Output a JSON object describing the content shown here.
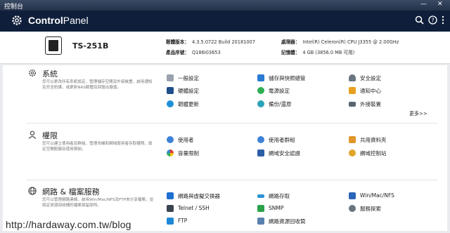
{
  "window": {
    "title": "控制台",
    "minimize": "—",
    "close": "✕"
  },
  "header": {
    "brand_bold": "Control",
    "brand_light": "Panel",
    "search_icon": "search-icon",
    "help_icon": "help-icon",
    "more_icon": "more-icon"
  },
  "device": {
    "model": "TS-251B",
    "firmware_label": "韌體版本：",
    "firmware_value": "4.3.5.0722 Build 20181007",
    "serial_label": "產品序號：",
    "serial_value": "Q186I03653",
    "cpu_label": "處理器：",
    "cpu_value": "Intel(R) Celeron(R) CPU J3355 @ 2.00GHz",
    "memory_label": "記憶體：",
    "memory_value": "4 GB (3856.0 MB 可用)"
  },
  "sections": {
    "system": {
      "title": "系統",
      "desc": "您可以更改所有系統設定，管理儲存空間及外接裝置，啟用通知及安全防護，或更新NAS韌體及回復出廠值。",
      "items": [
        {
          "label": "一般設定",
          "color": "#9aa3ad"
        },
        {
          "label": "儲存與快照總管",
          "color": "#2a7bd4"
        },
        {
          "label": "安全設定",
          "color": "#6b7580"
        },
        {
          "label": "硬體設定",
          "color": "#1f4e8c"
        },
        {
          "label": "電源設定",
          "color": "#2fae55"
        },
        {
          "label": "通知中心",
          "color": "#e8a020"
        },
        {
          "label": "韌體更新",
          "color": "#1e8fd6"
        },
        {
          "label": "備份/還原",
          "color": "#2aa3b8"
        },
        {
          "label": "外接裝置",
          "color": "#5a6470"
        }
      ],
      "more": "更多>>"
    },
    "privilege": {
      "title": "權限",
      "desc": "您可以建立使用者及群組，管理本機和網域使用者存取權限，設定空間配額及使用限制。",
      "items": [
        {
          "label": "使用者",
          "color": "#3d82d6"
        },
        {
          "label": "使用者群組",
          "color": "#3d82d6"
        },
        {
          "label": "共用資料夾",
          "color": "#e0962a"
        },
        {
          "label": "容量限制",
          "color": "#e23b2e"
        },
        {
          "label": "網域安全認證",
          "color": "#2b5fa8"
        },
        {
          "label": "網域控制站",
          "color": "#e0a52a"
        }
      ]
    },
    "network": {
      "title": "網路 & 檔案服務",
      "desc": "您可以管理網路連線，啟用Win/Mac/NFS及FTP來分享檔案，並設定資源回收桶的檔案保留原則。",
      "items": [
        {
          "label": "網路與虛擬交換器",
          "color": "#1e6fd0"
        },
        {
          "label": "網路存取",
          "color": "#2a92d6"
        },
        {
          "label": "Win/Mac/NFS",
          "color": "#2b66b8"
        },
        {
          "label": "Telnet / SSH",
          "color": "#3a4550"
        },
        {
          "label": "SNMP",
          "color": "#2aa24a"
        },
        {
          "label": "服務探索",
          "color": "#6a7480"
        },
        {
          "label": "FTP",
          "color": "#1e88d6"
        },
        {
          "label": "網路資源回收筒",
          "color": "#5a80b0"
        }
      ]
    }
  },
  "watermark": "http://hardaway.com.tw/blog"
}
